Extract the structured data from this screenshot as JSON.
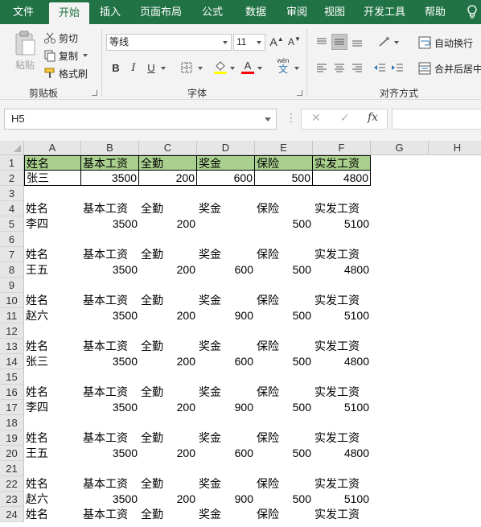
{
  "tabs": [
    "文件",
    "开始",
    "插入",
    "页面布局",
    "公式",
    "数据",
    "审阅",
    "视图",
    "开发工具",
    "帮助"
  ],
  "active_tab": "开始",
  "ribbon": {
    "clipboard": {
      "paste": "粘贴",
      "cut": "剪切",
      "copy": "复制",
      "format_painter": "格式刷",
      "label": "剪贴板"
    },
    "font": {
      "name": "等线",
      "size": "11",
      "bold": "B",
      "italic": "I",
      "underline": "U",
      "phonetic": "wén",
      "phonetic_char": "文",
      "grow": "A",
      "shrink": "A",
      "font_color_glyph": "A",
      "label": "字体"
    },
    "alignment": {
      "wrap_text": "自动换行",
      "merge_center": "合并后居中",
      "label": "对齐方式"
    }
  },
  "formula_bar": {
    "name_box": "H5",
    "cancel": "✕",
    "enter": "✓",
    "fx": "fx",
    "value": ""
  },
  "sheet": {
    "columns": [
      "A",
      "B",
      "C",
      "D",
      "E",
      "F",
      "G",
      "H"
    ],
    "row_numbers": [
      "1",
      "2",
      "3",
      "4",
      "5",
      "6",
      "7",
      "8",
      "9",
      "10",
      "11",
      "12",
      "13",
      "14",
      "15",
      "16",
      "17",
      "18",
      "19",
      "20",
      "21",
      "22",
      "23",
      "24"
    ],
    "header_fill": "#a9d08e",
    "rows": [
      [
        "姓名",
        "基本工资",
        "全勤",
        "奖金",
        "保险",
        "实发工资"
      ],
      [
        "张三",
        "3500",
        "200",
        "600",
        "500",
        "4800"
      ],
      [],
      [
        "姓名",
        "基本工资",
        "全勤",
        "奖金",
        "保险",
        "实发工资"
      ],
      [
        "李四",
        "3500",
        "200",
        "",
        "500",
        "5100"
      ],
      [],
      [
        "姓名",
        "基本工资",
        "全勤",
        "奖金",
        "保险",
        "实发工资"
      ],
      [
        "王五",
        "3500",
        "200",
        "600",
        "500",
        "4800"
      ],
      [],
      [
        "姓名",
        "基本工资",
        "全勤",
        "奖金",
        "保险",
        "实发工资"
      ],
      [
        "赵六",
        "3500",
        "200",
        "900",
        "500",
        "5100"
      ],
      [],
      [
        "姓名",
        "基本工资",
        "全勤",
        "奖金",
        "保险",
        "实发工资"
      ],
      [
        "张三",
        "3500",
        "200",
        "600",
        "500",
        "4800"
      ],
      [],
      [
        "姓名",
        "基本工资",
        "全勤",
        "奖金",
        "保险",
        "实发工资"
      ],
      [
        "李四",
        "3500",
        "200",
        "900",
        "500",
        "5100"
      ],
      [],
      [
        "姓名",
        "基本工资",
        "全勤",
        "奖金",
        "保险",
        "实发工资"
      ],
      [
        "王五",
        "3500",
        "200",
        "600",
        "500",
        "4800"
      ],
      [],
      [
        "姓名",
        "基本工资",
        "全勤",
        "奖金",
        "保险",
        "实发工资"
      ],
      [
        "赵六",
        "3500",
        "200",
        "900",
        "500",
        "5100"
      ],
      [
        "姓名",
        "基本工资",
        "全勤",
        "奖金",
        "保险",
        "实发工资"
      ]
    ]
  }
}
